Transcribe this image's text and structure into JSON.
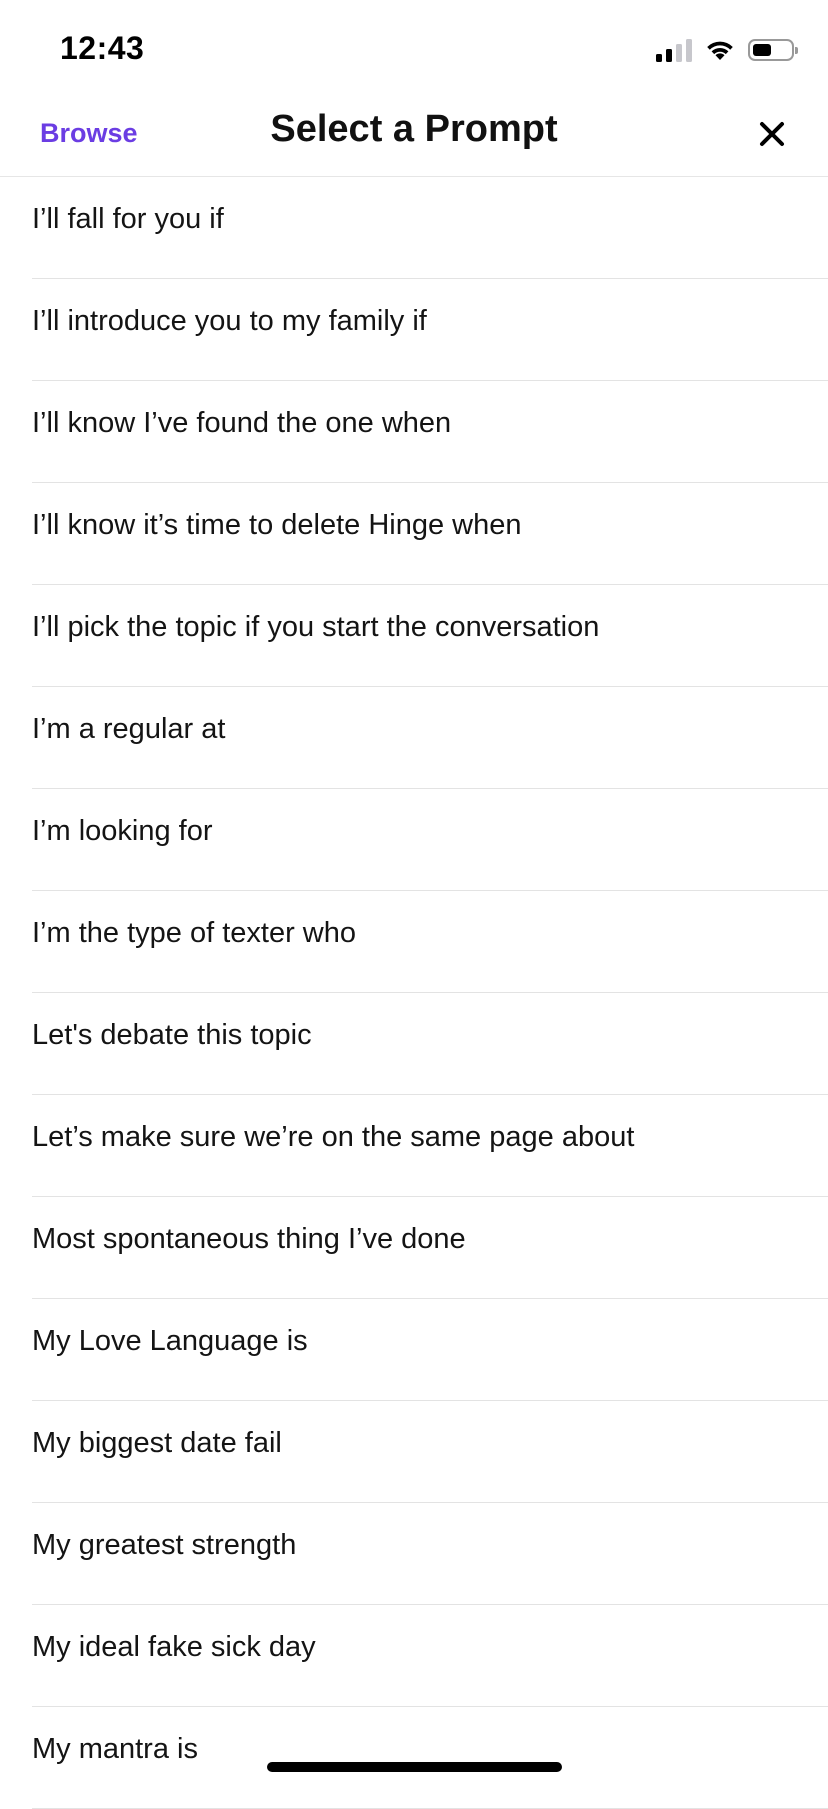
{
  "status_bar": {
    "time": "12:43",
    "icons": [
      "cellular-signal-icon",
      "wifi-icon",
      "battery-icon"
    ]
  },
  "header": {
    "browse_label": "Browse",
    "title": "Select a Prompt",
    "close_icon": "close-icon"
  },
  "colors": {
    "accent": "#6b3de3",
    "text": "#141414",
    "divider": "#e3e3e3"
  },
  "prompts": [
    "I’ll fall for you if",
    "I’ll introduce you to my family if",
    "I’ll know I’ve found the one when",
    "I’ll know it’s time to delete Hinge when",
    "I’ll pick the topic if you start the conversation",
    "I’m a regular at",
    "I’m looking for",
    "I’m the type of texter who",
    "Let's debate this topic",
    "Let’s make sure we’re on the same page about",
    "Most spontaneous thing I’ve done",
    "My Love Language is",
    "My biggest date fail",
    "My greatest strength",
    "My ideal fake sick day",
    "My mantra is"
  ]
}
